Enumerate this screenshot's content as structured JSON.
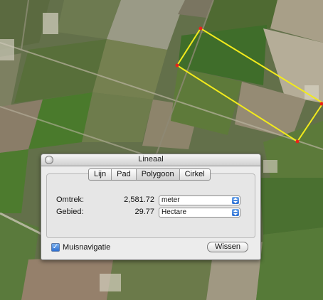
{
  "window": {
    "title": "Lineaal"
  },
  "tabs": [
    "Lijn",
    "Pad",
    "Polygoon",
    "Cirkel"
  ],
  "measurements": {
    "perimeter": {
      "label": "Omtrek:",
      "value": "2,581.72",
      "unit": "meter"
    },
    "area": {
      "label": "Gebied:",
      "value": "29.77",
      "unit": "Hectare"
    }
  },
  "options": {
    "mouse_navigation_label": "Muisnavigatie",
    "mouse_navigation_checked": true
  },
  "buttons": {
    "clear_label": "Wissen"
  },
  "colors": {
    "polygon_stroke": "#f2ea1c",
    "vertex": "#e8241a"
  }
}
